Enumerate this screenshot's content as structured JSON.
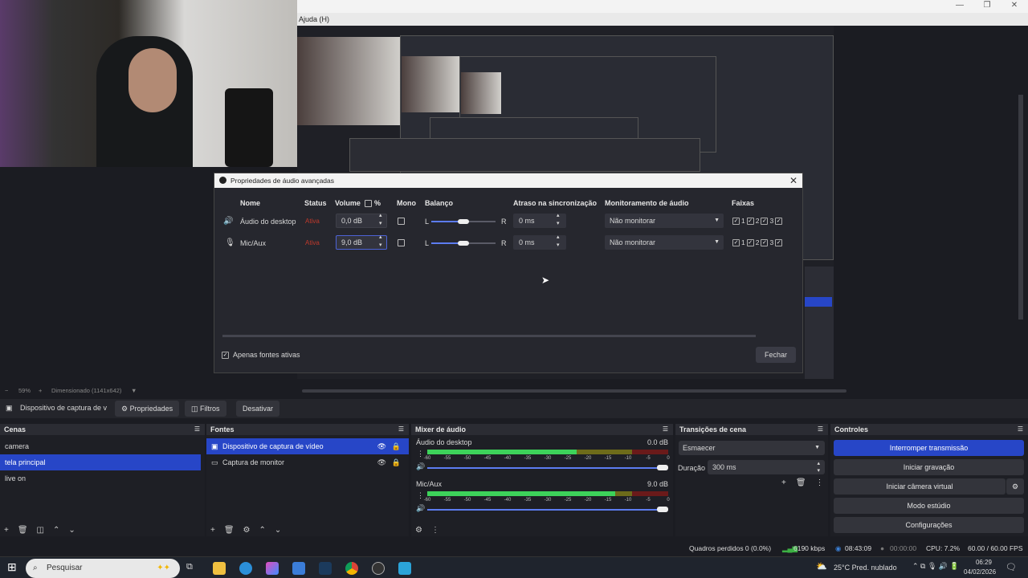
{
  "window": {
    "menu_item": "Ajuda (H)",
    "minimize": "—",
    "restore": "❐",
    "close": "✕"
  },
  "dialog": {
    "title": "Propriedades de áudio avançadas",
    "close": "✕",
    "headers": {
      "name": "Nome",
      "status": "Status",
      "volume": "Volume",
      "percent": "%",
      "mono": "Mono",
      "balance": "Balanço",
      "sync": "Atraso na sincronização",
      "monitor": "Monitoramento de áudio",
      "tracks": "Faixas"
    },
    "rows": [
      {
        "name": "Áudio do desktop",
        "status": "Ativa",
        "volume": "0,0 dB",
        "balance_left": "L",
        "balance_right": "R",
        "balance_value": 0.5,
        "sync": "0 ms",
        "monitor": "Não monitorar",
        "tracks": [
          "1",
          "2",
          "3"
        ]
      },
      {
        "name": "Mic/Aux",
        "status": "Ativa",
        "volume": "9,0 dB",
        "balance_left": "L",
        "balance_right": "R",
        "balance_value": 0.5,
        "sync": "0 ms",
        "monitor": "Não monitorar",
        "tracks": [
          "1",
          "2",
          "3"
        ]
      }
    ],
    "only_active": "Apenas fontes ativas",
    "close_button": "Fechar"
  },
  "preview": {
    "zoom": "59%",
    "zoom_minus": "−",
    "zoom_plus": "+",
    "scale": "Dimensionado (1141x642)"
  },
  "context": {
    "source": "Dispositivo de captura de v",
    "properties": "Propriedades",
    "filters": "Filtros",
    "deactivate": "Desativar"
  },
  "scenes": {
    "title": "Cenas",
    "items": [
      "camera",
      "tela principal",
      "live on"
    ],
    "selected": 1
  },
  "sources": {
    "title": "Fontes",
    "items": [
      "Dispositivo de captura de vídeo",
      "Captura de monitor"
    ]
  },
  "mixer": {
    "title": "Mixer de áudio",
    "channels": [
      {
        "name": "Áudio do desktop",
        "db": "0.0 dB",
        "level": 0.62
      },
      {
        "name": "Mic/Aux",
        "db": "9.0 dB",
        "level": 0.78
      }
    ],
    "ticks": [
      "-60",
      "-55",
      "-50",
      "-45",
      "-40",
      "-35",
      "-30",
      "-25",
      "-20",
      "-15",
      "-10",
      "-5",
      "0"
    ]
  },
  "transitions": {
    "title": "Transições de cena",
    "selected": "Esmaecer",
    "duration_label": "Duração",
    "duration": "300 ms"
  },
  "controls": {
    "title": "Controles",
    "stop_stream": "Interromper transmissão",
    "start_rec": "Iniciar gravação",
    "virtual_cam": "Iniciar câmera virtual",
    "studio": "Modo estúdio",
    "settings": "Configurações"
  },
  "status": {
    "dropped": "Quadros perdidos 0 (0.0%)",
    "bitrate": "6190 kbps",
    "live_time": "08:43:09",
    "rec_time": "00:00:00",
    "cpu": "CPU: 7.2%",
    "fps": "60.00 / 60.00 FPS"
  },
  "taskbar": {
    "search": "Pesquisar",
    "weather": "25°C  Pred. nublado",
    "time": "06:29",
    "date": "04/02/2026"
  },
  "colors": {
    "accent": "#2746c7",
    "status_red": "#c0392b"
  }
}
